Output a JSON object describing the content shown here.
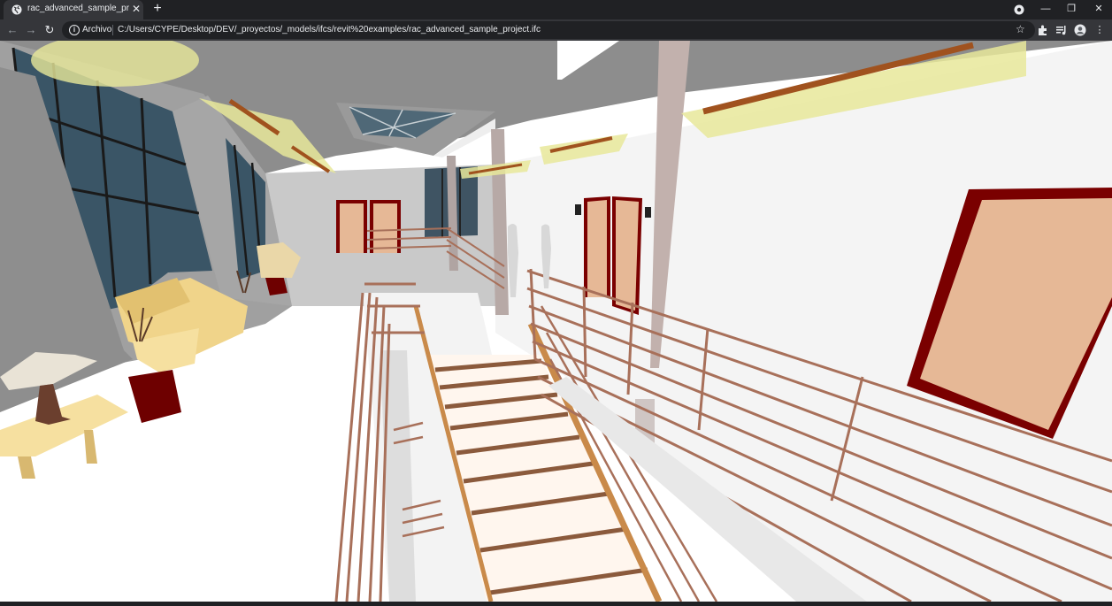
{
  "browser": {
    "tab": {
      "title": "rac_advanced_sample_project.ifc",
      "close_glyph": "✕"
    },
    "new_tab_glyph": "+",
    "window_controls": {
      "minimize": "—",
      "restore": "❐",
      "close": "✕"
    },
    "nav": {
      "back": "←",
      "forward": "→",
      "reload": "↻"
    },
    "address": {
      "info_glyph": "i",
      "scheme_label": "Archivo",
      "url": "C:/Users/CYPE/Desktop/DEV/_proyectos/_models/ifcs/revit%20examples/rac_advanced_sample_project.ifc"
    },
    "toolbar_icons": [
      "star-icon",
      "extensions-icon",
      "media-icon",
      "profile-avatar",
      "menu-icon"
    ],
    "star_glyph": "☆",
    "menu_glyph": "⋮"
  },
  "scene": {
    "description_icon": "3d-model-viewer",
    "colors": {
      "wall_white": "#f4f4f4",
      "ceiling_grey": "#8c8c8c",
      "door_frame": "#7a0000",
      "door_panel": "#e6b896",
      "railing": "#a8705a",
      "stair_tread": "#fff6ee",
      "stair_nosing": "#8b5a3c",
      "light_fixture": "#e8e89a",
      "light_bar": "#a0521e",
      "glass": "#3a5566",
      "sofa": "#f0d48a",
      "ottoman": "#6e0000",
      "floor": "#ffffff"
    }
  }
}
